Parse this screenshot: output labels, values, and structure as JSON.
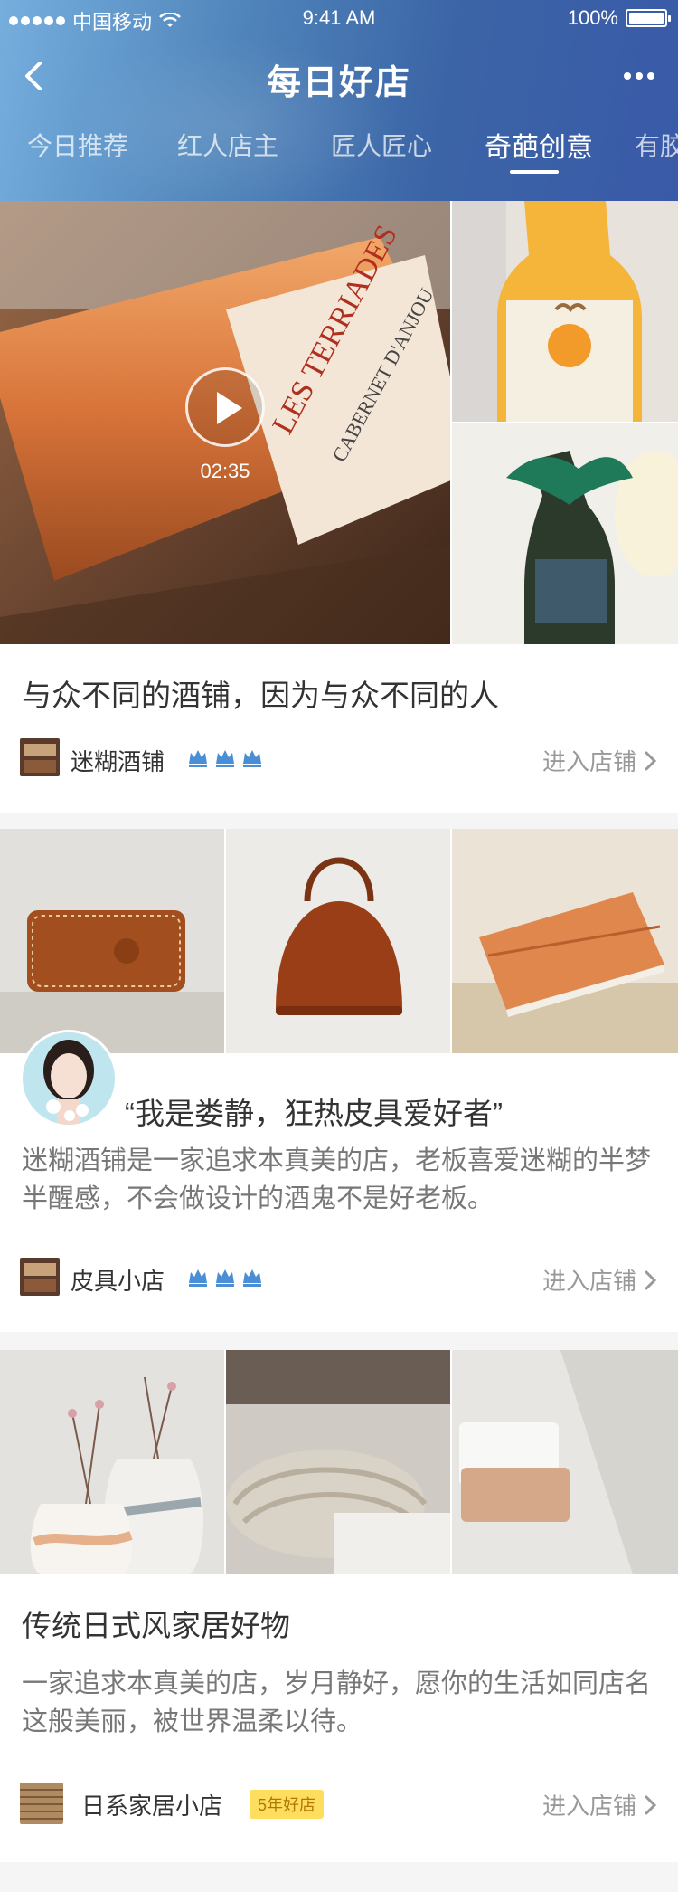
{
  "status": {
    "carrier": "中国移动",
    "time": "9:41 AM",
    "battery": "100%",
    "battery_level": 1.0
  },
  "nav": {
    "title": "每日好店"
  },
  "tabs": [
    "今日推荐",
    "红人店主",
    "匠人匠心",
    "奇葩创意",
    "有胶"
  ],
  "active_tab": 3,
  "cards": [
    {
      "title": "与众不同的酒铺，因为与众不同的人",
      "video_duration": "02:35",
      "shop_name": "迷糊酒铺",
      "crowns": 3,
      "enter_label": "进入店铺"
    },
    {
      "title": "“我是娄静，狂热皮具爱好者”",
      "desc": "迷糊酒铺是一家追求本真美的店，老板喜爱迷糊的半梦半醒感，不会做设计的酒鬼不是好老板。",
      "shop_name": "皮具小店",
      "crowns": 3,
      "enter_label": "进入店铺"
    },
    {
      "title": "传统日式风家居好物",
      "desc": "一家追求本真美的店，岁月静好，愿你的生活如同店名这般美丽，被世界温柔以待。",
      "shop_name": "日系家居小店",
      "badge": "5年好店",
      "enter_label": "进入店铺"
    }
  ],
  "colors": {
    "header_start": "#76aede",
    "header_end": "#3a5aa8",
    "badge_bg": "#ffde5f",
    "crown": "#4a8fd6"
  }
}
